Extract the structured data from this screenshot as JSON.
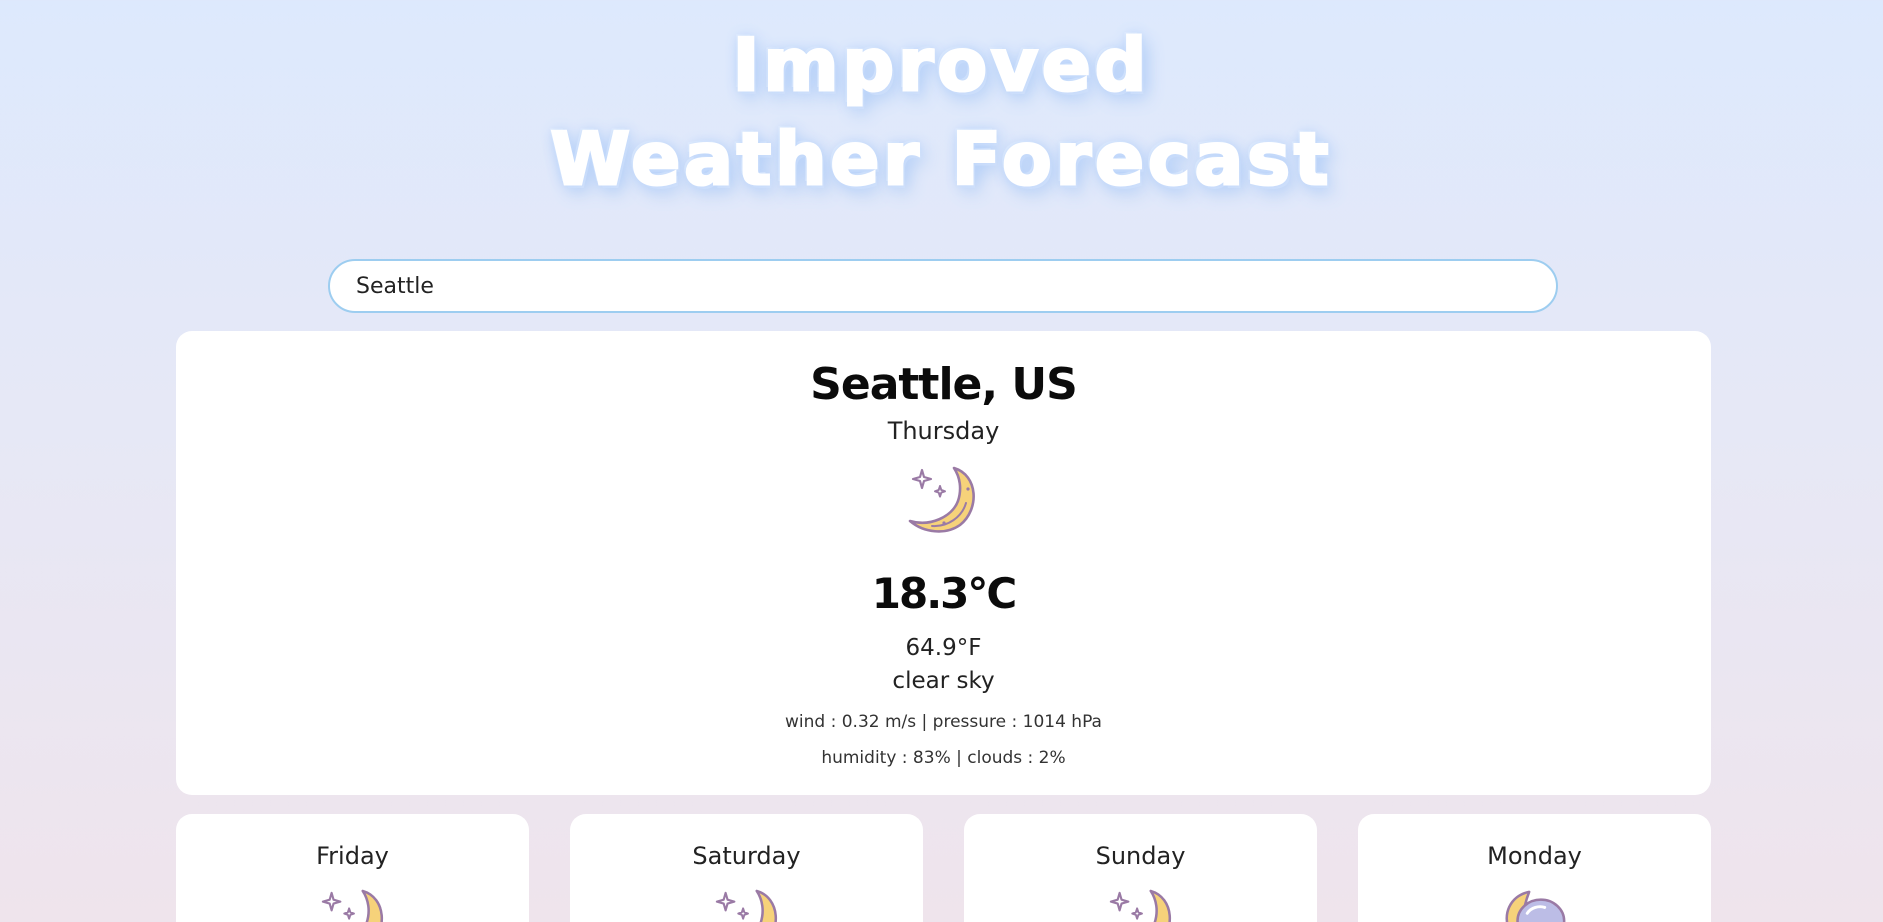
{
  "header": {
    "title_line1": "Improved",
    "title_line2": "Weather Forecast"
  },
  "search": {
    "value": "Seattle"
  },
  "current": {
    "city": "Seattle, US",
    "day": "Thursday",
    "icon": "moon-stars-icon",
    "temp_c": "18.3°C",
    "temp_f": "64.9°F",
    "description": "clear sky",
    "details_line1": "wind : 0.32 m/s | pressure : 1014 hPa",
    "details_line2": "humidity : 83% | clouds : 2%"
  },
  "forecast": [
    {
      "day": "Friday",
      "icon": "moon-stars-icon"
    },
    {
      "day": "Saturday",
      "icon": "moon-stars-icon"
    },
    {
      "day": "Sunday",
      "icon": "moon-stars-icon"
    },
    {
      "day": "Monday",
      "icon": "moon-cloud-icon"
    }
  ],
  "colors": {
    "moon_fill": "#f6d27a",
    "icon_stroke": "#9a7aa5",
    "cloud_fill": "#bcbde6",
    "search_border": "#9dcdf0"
  }
}
